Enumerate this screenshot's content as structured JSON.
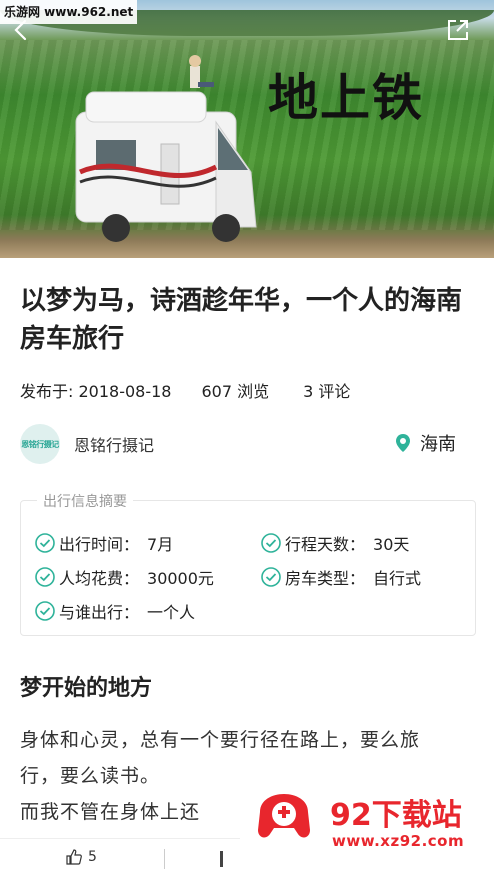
{
  "watermark_top": {
    "text": "乐游网 www.962.net"
  },
  "hero": {
    "slogan": "地上铁"
  },
  "article": {
    "title": "以梦为马，诗酒趁年华，一个人的海南房车旅行",
    "date": "发布于: 2018-08-18",
    "views": "607 浏览",
    "comments": "3 评论"
  },
  "author": {
    "avatar_text": "恩铭行摄记",
    "name": "恩铭行摄记"
  },
  "location": {
    "name": "海南"
  },
  "summary": {
    "title": "出行信息摘要",
    "items": [
      {
        "label": "出行时间：",
        "value": "7月"
      },
      {
        "label": "行程天数：",
        "value": "30天"
      },
      {
        "label": "人均花费：",
        "value": "30000元"
      },
      {
        "label": "房车类型：",
        "value": "自行式"
      },
      {
        "label": "与谁出行：",
        "value": "一个人"
      }
    ]
  },
  "section": {
    "title": "梦开始的地方"
  },
  "body": {
    "line1": "身体和心灵，总有一个要行径在路上，要么旅",
    "line2": "行，要么读书。",
    "line3": "而我不管在身体上还"
  },
  "bottom_bar": {
    "likes": "5"
  },
  "watermark_92": {
    "title": "92下载站",
    "url": "www.xz92.com"
  },
  "colors": {
    "accent": "#2fb39a",
    "watermark_red": "#e8262d"
  }
}
